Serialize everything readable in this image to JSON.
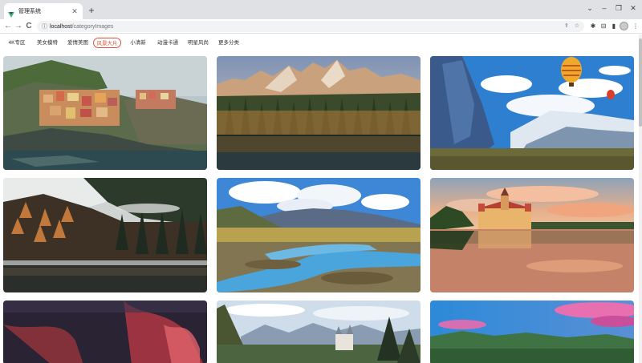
{
  "browser": {
    "tab_title": "管理系统",
    "tab_close": "✕",
    "new_tab": "+",
    "win_chevron": "⌄",
    "win_min": "–",
    "win_max": "❐",
    "win_close": "✕",
    "back": "←",
    "forward": "→",
    "reload": "C",
    "info_icon": "ⓘ",
    "url_host": "localhost",
    "url_path": "/categoryImages",
    "share_icon": "⇪",
    "star_icon": "☆",
    "extensions": [
      "✱",
      "⊟",
      "▮",
      "⋮"
    ]
  },
  "categories": [
    {
      "label": "4K专区",
      "active": false
    },
    {
      "label": "美女模特",
      "active": false
    },
    {
      "label": "爱情美图",
      "active": false
    },
    {
      "label": "风景大片",
      "active": true
    },
    {
      "label": "小清新",
      "active": false
    },
    {
      "label": "动漫卡通",
      "active": false
    },
    {
      "label": "明星风尚",
      "active": false
    },
    {
      "label": "更多分类",
      "active": false
    }
  ],
  "colors": {
    "accent": "#e0533c",
    "tabstrip": "#dfe1e5"
  },
  "images": [
    {
      "name": "cinque-terre-village"
    },
    {
      "name": "dolomites-autumn-lake"
    },
    {
      "name": "mountain-hot-air-balloons"
    },
    {
      "name": "misty-autumn-forest-lake"
    },
    {
      "name": "river-valley-mountains"
    },
    {
      "name": "castle-lake-sunset"
    },
    {
      "name": "aurora-night-sky"
    },
    {
      "name": "alpine-castle"
    },
    {
      "name": "pink-sky-hills"
    }
  ]
}
